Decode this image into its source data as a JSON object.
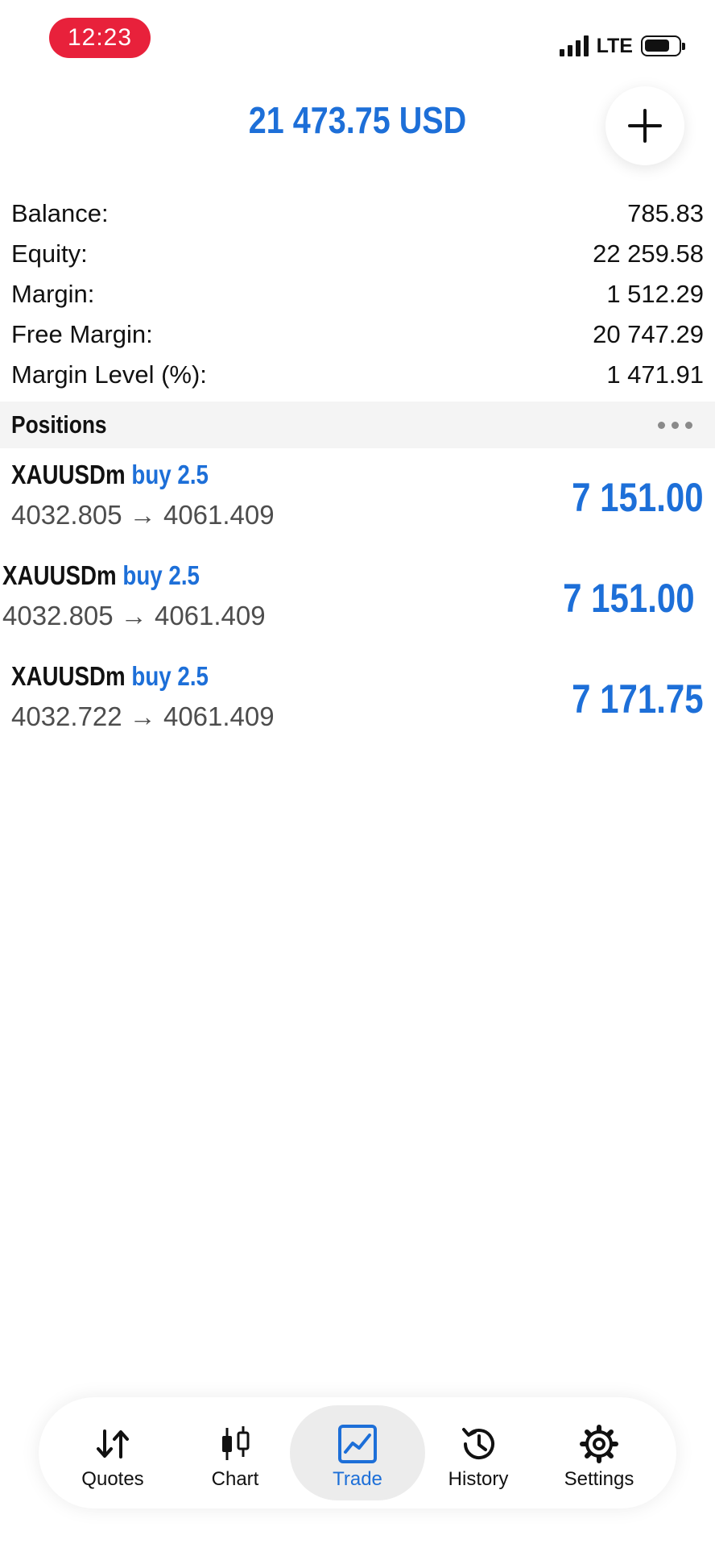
{
  "status_bar": {
    "time": "12:23",
    "network": "LTE",
    "colors": {
      "time_pill": "#e8213b"
    }
  },
  "header": {
    "total": "21 473.75 USD",
    "add_icon": "plus-icon",
    "colors": {
      "accent": "#1d6fd8"
    }
  },
  "summary": [
    {
      "label": "Balance:",
      "value": "785.83"
    },
    {
      "label": "Equity:",
      "value": "22 259.58"
    },
    {
      "label": "Margin:",
      "value": "1 512.29"
    },
    {
      "label": "Free Margin:",
      "value": "20 747.29"
    },
    {
      "label": "Margin Level (%):",
      "value": "1 471.91"
    }
  ],
  "positions": {
    "title": "Positions",
    "more_icon": "more-dots-icon",
    "items": [
      {
        "symbol": "XAUUSDm",
        "type": "buy 2.5",
        "prices": "4032.805 → 4061.409",
        "profit": "7 151.00"
      },
      {
        "symbol": "XAUUSDm",
        "type": "buy 2.5",
        "prices": "4032.805 → 4061.409",
        "profit": "7 151.00"
      },
      {
        "symbol": "XAUUSDm",
        "type": "buy 2.5",
        "prices": "4032.722 → 4061.409",
        "profit": "7 171.75"
      }
    ]
  },
  "tabbar": {
    "active": "Trade",
    "tabs": [
      {
        "label": "Quotes",
        "icon": "quotes-arrows-icon"
      },
      {
        "label": "Chart",
        "icon": "candlestick-icon"
      },
      {
        "label": "Trade",
        "icon": "trade-chart-icon"
      },
      {
        "label": "History",
        "icon": "history-icon"
      },
      {
        "label": "Settings",
        "icon": "gear-icon"
      }
    ]
  }
}
